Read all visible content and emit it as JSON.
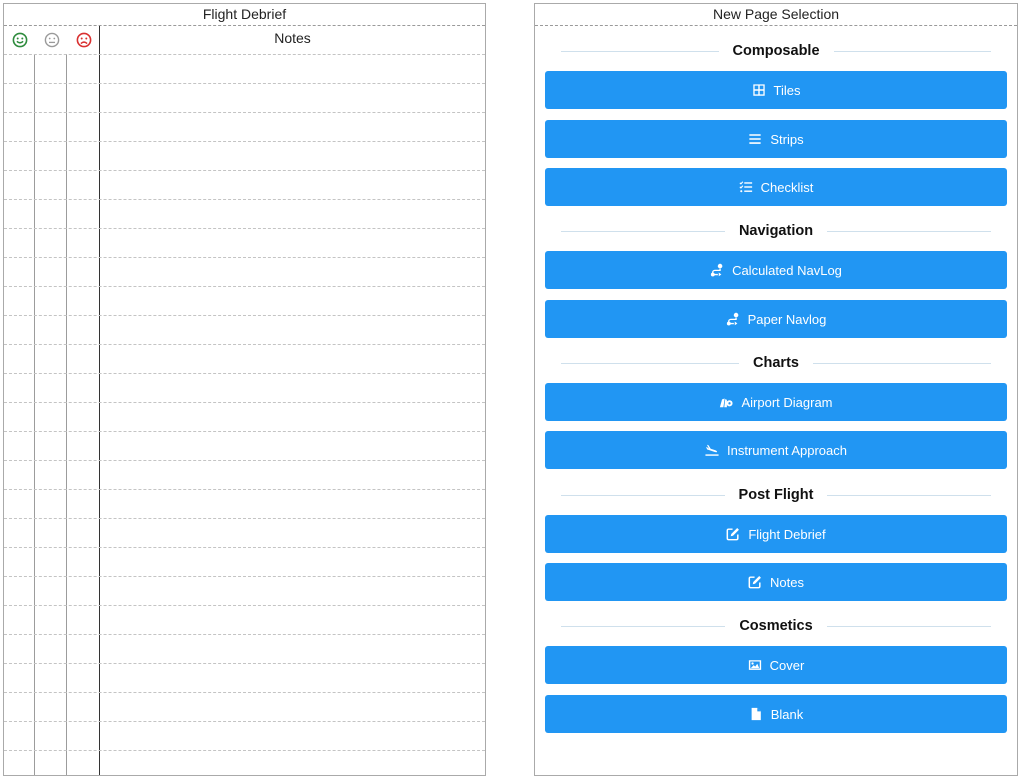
{
  "debrief": {
    "title": "Flight Debrief",
    "notes_header": "Notes",
    "colors": {
      "good": "#2e8b3d",
      "neutral": "#9a9a9a",
      "bad": "#d93030"
    }
  },
  "selection": {
    "title": "New Page Selection",
    "sections": [
      {
        "label": "Composable",
        "buttons": [
          {
            "label": "Tiles",
            "icon": "grid-icon"
          },
          {
            "label": "Strips",
            "icon": "list-icon"
          },
          {
            "label": "Checklist",
            "icon": "checklist-icon"
          }
        ]
      },
      {
        "label": "Navigation",
        "buttons": [
          {
            "label": "Calculated NavLog",
            "icon": "route-icon"
          },
          {
            "label": "Paper Navlog",
            "icon": "route-icon"
          }
        ]
      },
      {
        "label": "Charts",
        "buttons": [
          {
            "label": "Airport Diagram",
            "icon": "map-location-icon"
          },
          {
            "label": "Instrument Approach",
            "icon": "plane-landing-icon"
          }
        ]
      },
      {
        "label": "Post Flight",
        "buttons": [
          {
            "label": "Flight Debrief",
            "icon": "edit-icon"
          },
          {
            "label": "Notes",
            "icon": "edit-icon"
          }
        ]
      },
      {
        "label": "Cosmetics",
        "buttons": [
          {
            "label": "Cover",
            "icon": "image-icon"
          },
          {
            "label": "Blank",
            "icon": "file-icon"
          }
        ]
      }
    ],
    "accent": "#2196f3"
  }
}
